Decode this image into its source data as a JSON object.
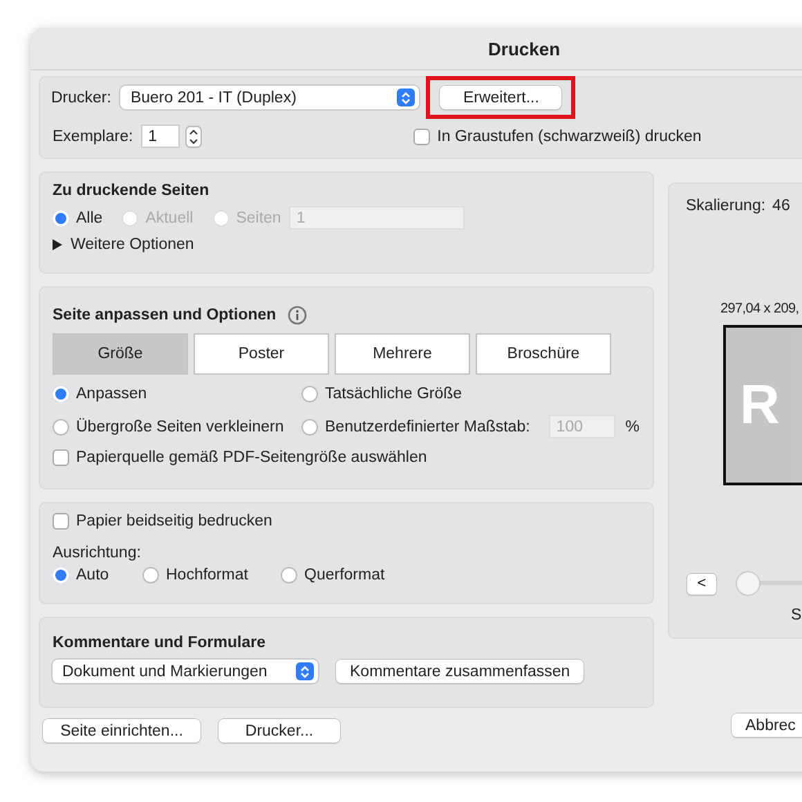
{
  "window": {
    "title": "Drucken"
  },
  "printer": {
    "label": "Drucker:",
    "value": "Buero 201 - IT (Duplex)",
    "advanced_button": "Erweitert...",
    "highlighted": true
  },
  "copies": {
    "label": "Exemplare:",
    "value": "1"
  },
  "grayscale": {
    "label": "In Graustufen (schwarzweiß) drucken",
    "checked": false
  },
  "pages": {
    "title": "Zu druckende Seiten",
    "options": [
      {
        "label": "Alle",
        "selected": true,
        "disabled": false
      },
      {
        "label": "Aktuell",
        "selected": false,
        "disabled": true
      },
      {
        "label": "Seiten",
        "selected": false,
        "disabled": true
      }
    ],
    "range": {
      "value": "1",
      "disabled": true
    },
    "more": {
      "label": "Weitere Optionen",
      "expanded": false
    }
  },
  "fit": {
    "title": "Seite anpassen und Optionen",
    "tabs": [
      {
        "label": "Größe",
        "selected": true
      },
      {
        "label": "Poster",
        "selected": false
      },
      {
        "label": "Mehrere",
        "selected": false
      },
      {
        "label": "Broschüre",
        "selected": false
      }
    ],
    "options": [
      {
        "label": "Anpassen",
        "selected": true
      },
      {
        "label": "Tatsächliche Größe",
        "selected": false
      },
      {
        "label": "Übergroße Seiten verkleinern",
        "selected": false
      },
      {
        "label": "Benutzerdefinierter Maßstab:",
        "selected": false
      }
    ],
    "scale": {
      "value": "100",
      "unit": "%",
      "disabled": true
    },
    "paper_source": {
      "label": "Papierquelle gemäß PDF-Seitengröße auswählen",
      "checked": false
    }
  },
  "duplex": {
    "label": "Papier beidseitig bedrucken",
    "checked": false
  },
  "orientation": {
    "label": "Ausrichtung:",
    "options": [
      {
        "label": "Auto",
        "selected": true
      },
      {
        "label": "Hochformat",
        "selected": false
      },
      {
        "label": "Querformat",
        "selected": false
      }
    ]
  },
  "comments": {
    "title": "Kommentare und Formulare",
    "select": "Dokument und Markierungen",
    "button": "Kommentare zusammenfassen"
  },
  "footer": {
    "buttons": [
      "Seite einrichten...",
      "Drucker..."
    ],
    "cancel": "Abbrec"
  },
  "preview": {
    "scaling_label": "Skalierung:",
    "scaling_value": "46",
    "size": "297,04 x 209,",
    "watermark": "R",
    "prev_button": "<",
    "slider": {
      "level": 0
    },
    "page_label": "S"
  }
}
